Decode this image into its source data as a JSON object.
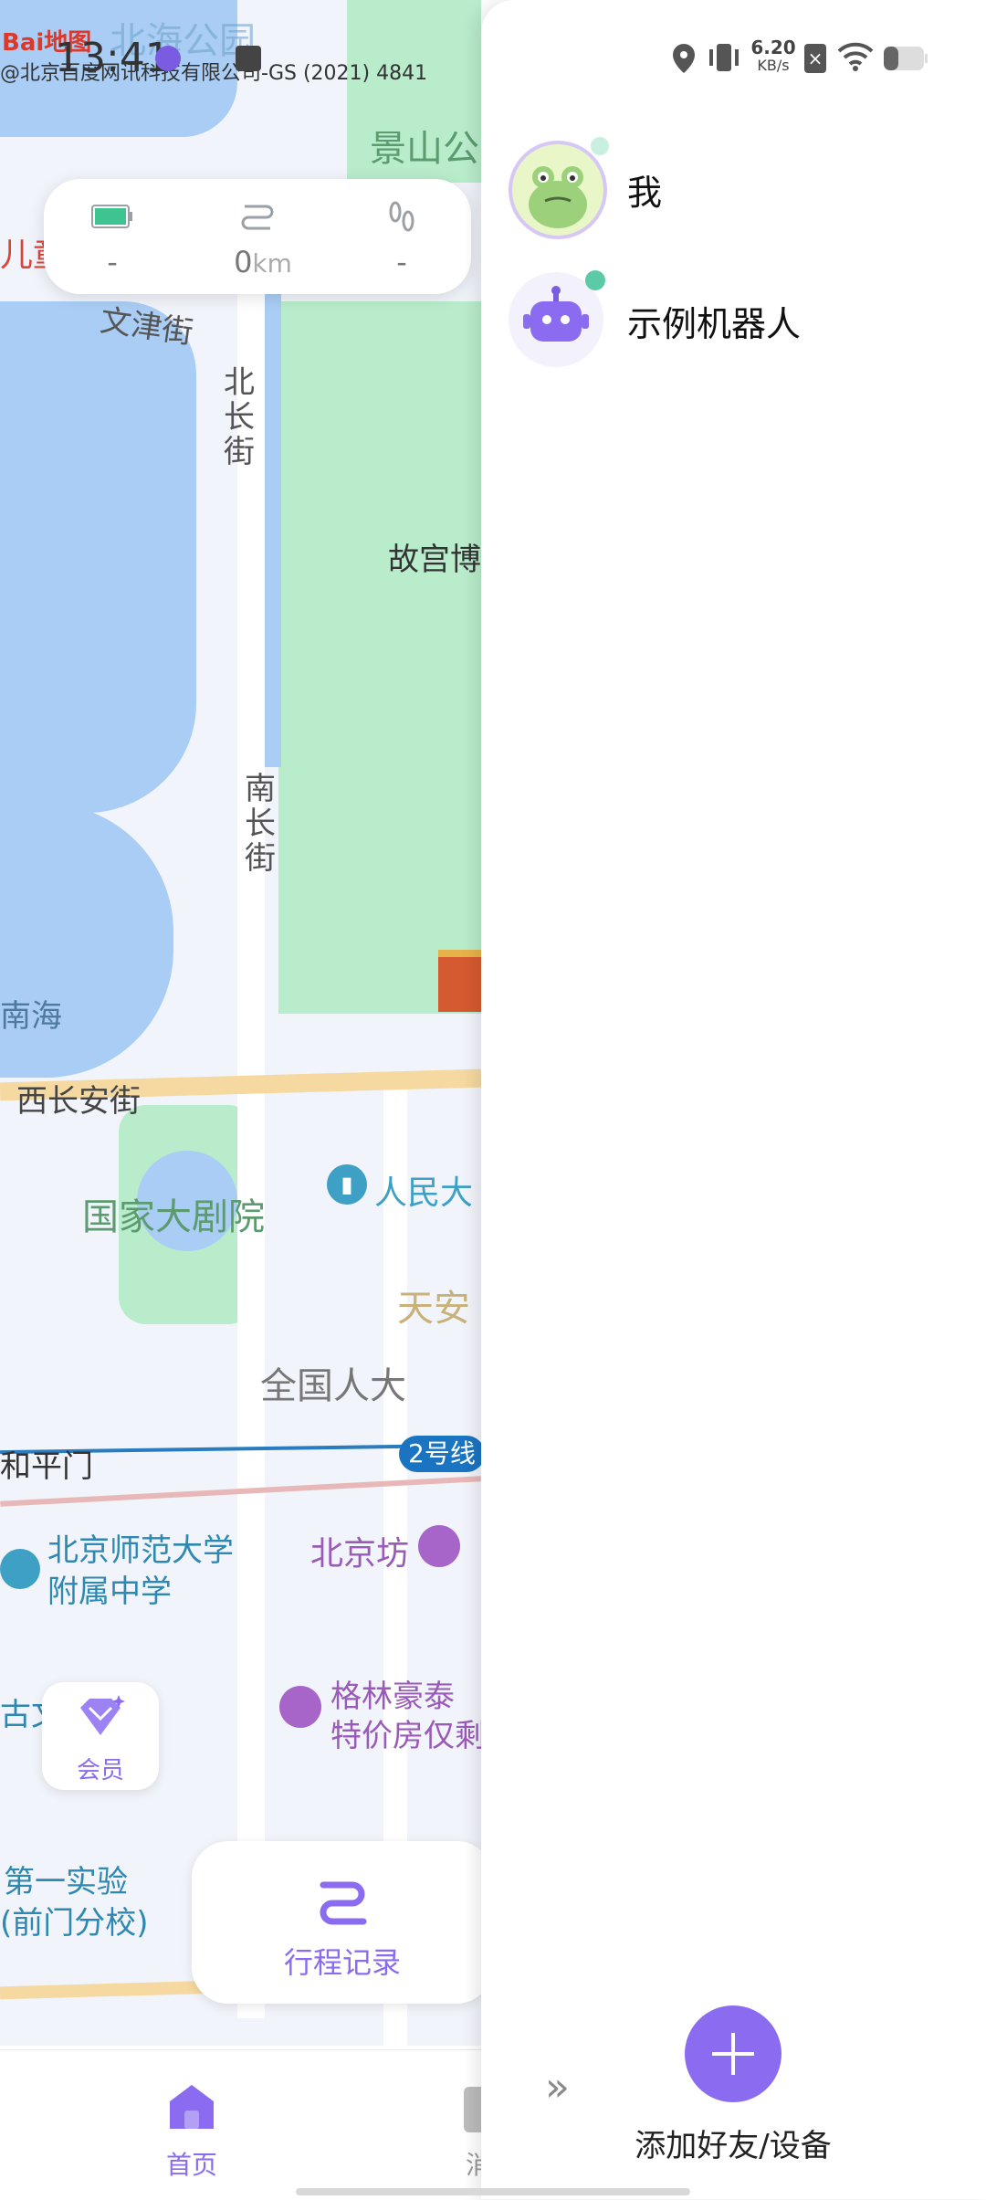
{
  "status_bar": {
    "time": "13:41",
    "network_speed_value": "6.20",
    "network_speed_unit": "KB/s"
  },
  "map": {
    "attribution": "@北京百度网讯科技有限公司-GS (2021) 4841",
    "logo_text": "Bai地图",
    "labels": {
      "beihai": "北海公园",
      "jingshan": "景山公",
      "children": "儿童",
      "wenjin": "文津街",
      "beichang": "北长街",
      "gugong": "故宫博",
      "nanchang": "南长街",
      "nanhai": "南海",
      "xichangan": "西长安街",
      "guojia": "国家大剧院",
      "renmin": "人民大",
      "tianan": "天安",
      "quanguo": "全国人大",
      "hepingmen": "和平门",
      "line2": "2号线",
      "beishida": "北京师范大学",
      "fushu": "附属中学",
      "beijingfang": "北京坊",
      "wen": "古文",
      "gelin1": "格林豪泰",
      "gelin2": "特价房仅剩",
      "diyi1": "第一实验",
      "diyi2": "(前门分校)"
    }
  },
  "stats": {
    "battery_value": "-",
    "distance_number": "0",
    "distance_unit": "km",
    "steps_value": "-"
  },
  "vip_label": "会员",
  "trip_record_label": "行程记录",
  "bottom_nav": {
    "home_label": "首页",
    "second_label": "消"
  },
  "friends": [
    {
      "name": "我"
    },
    {
      "name": "示例机器人"
    }
  ],
  "add_friend_label": "添加好友/设备",
  "colors": {
    "accent": "#8b6cf0",
    "online": "#5cc9a7"
  }
}
